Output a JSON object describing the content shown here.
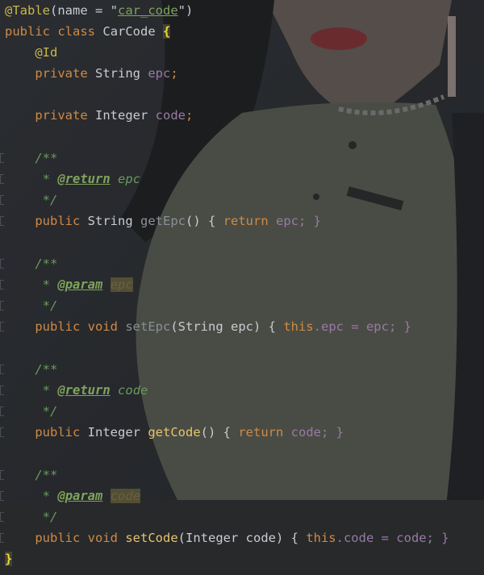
{
  "annotation_table": "@Table",
  "table_args_open": "(name = \"",
  "table_name": "car_code",
  "table_args_close": "\")",
  "class_decl": {
    "public": "public",
    "class": "class",
    "name": "CarCode",
    "brace": "{"
  },
  "id_annotation": "@Id",
  "fields": [
    {
      "modifier": "private",
      "type": "String",
      "name": "epc"
    },
    {
      "modifier": "private",
      "type": "Integer",
      "name": "code"
    }
  ],
  "javadoc": {
    "open": "/**",
    "star": "*",
    "close": "*/",
    "return_tag": "@return",
    "param_tag": "@param"
  },
  "methods": [
    {
      "modifier": "public",
      "ret": "String",
      "name": "getEpc",
      "sig": "() { ",
      "body_kw": "return",
      "body": " epc; }",
      "doc_name": "epc"
    },
    {
      "modifier": "public",
      "ret": "void",
      "name": "setEpc",
      "sig": "(String epc) { ",
      "body_kw": "this",
      "body": ".epc = epc; }",
      "doc_name": "epc"
    },
    {
      "modifier": "public",
      "ret": "Integer",
      "name": "getCode",
      "sig": "() { ",
      "body_kw": "return",
      "body": " code; }",
      "doc_name": "code"
    },
    {
      "modifier": "public",
      "ret": "void",
      "name": "setCode",
      "sig": "(Integer code) { ",
      "body_kw": "this",
      "body": ".code = code; }",
      "doc_name": "code"
    }
  ],
  "closing_brace": "}",
  "colors": {
    "keyword": "#d08a45",
    "annotation": "#c9b84b",
    "field": "#9a79a6",
    "method": "#e8c46a",
    "comment": "#6a9a5b",
    "text": "#c8cbd0"
  }
}
